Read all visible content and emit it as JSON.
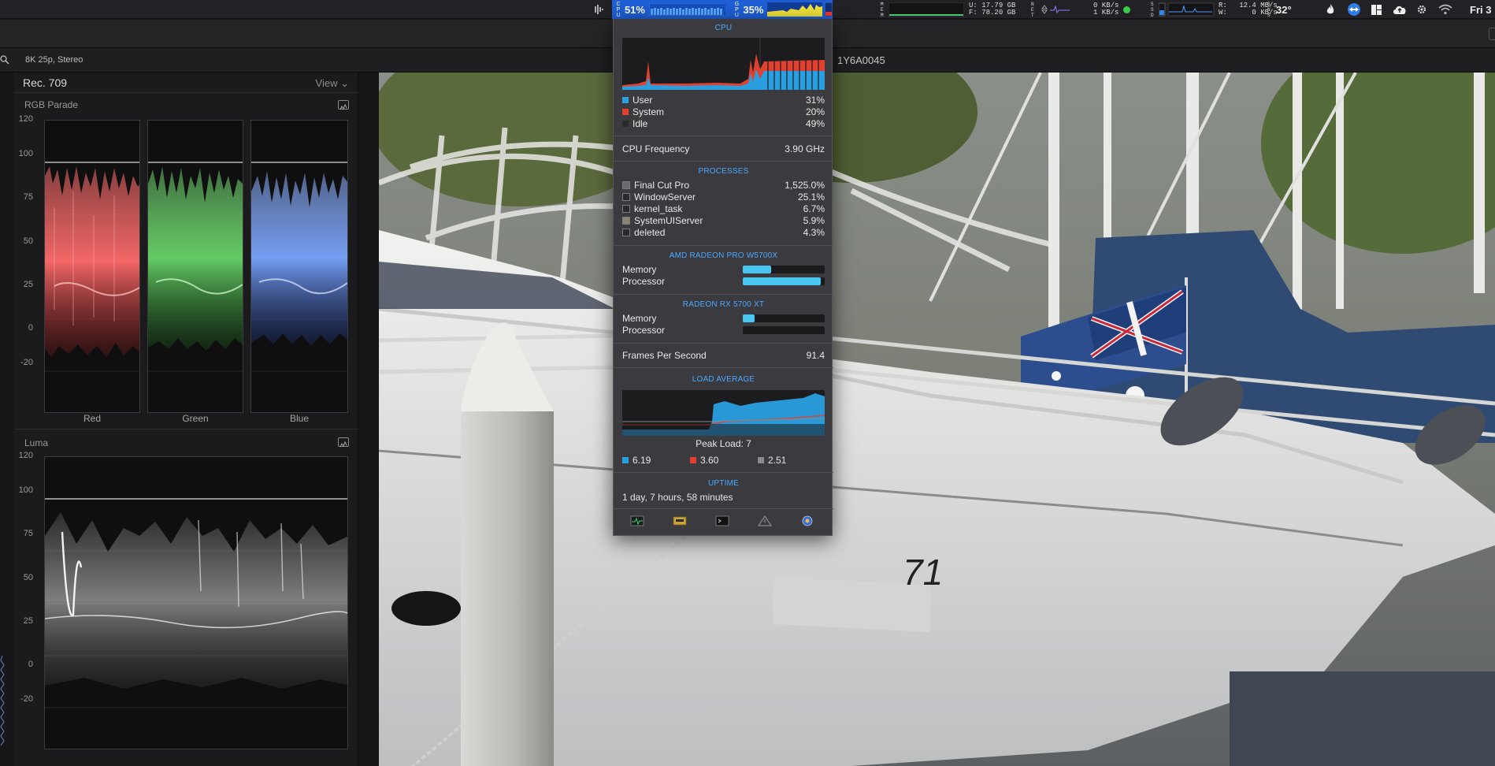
{
  "menubar": {
    "cpu_percent": "51%",
    "gpu_percent": "35%",
    "cpu_tag": "CPU",
    "gpu_tag": "GPU",
    "mem_tag": "MEM",
    "mem_used_label": "U:",
    "mem_used": "17.79 GB",
    "mem_free_label": "F:",
    "mem_free": "78.20 GB",
    "net_tag": "NET",
    "net_up": "0 KB/s",
    "net_down": "1 KB/s",
    "disk_tag": "SSD",
    "disk_read_label": "R:",
    "disk_read": "12.4 MB/s",
    "disk_write_label": "W:",
    "disk_write": "0 KB/s",
    "sensor_tag": "SNS",
    "temperature": "32°",
    "clock": "Fri 3"
  },
  "subbar": {
    "format": "8K 25p, Stereo",
    "clip_name": "1Y6A0045"
  },
  "scopes": {
    "standard": "Rec. 709",
    "view_label": "View ⌄",
    "rgb_title": "RGB Parade",
    "luma_title": "Luma",
    "axis_ticks": [
      "120",
      "100",
      "75",
      "50",
      "25",
      "0",
      "-20"
    ],
    "channels": [
      "Red",
      "Green",
      "Blue"
    ]
  },
  "dropdown": {
    "cpu_header": "CPU",
    "user_label": "User",
    "user_value": "31%",
    "system_label": "System",
    "system_value": "20%",
    "idle_label": "Idle",
    "idle_value": "49%",
    "freq_label": "CPU Frequency",
    "freq_value": "3.90 GHz",
    "processes_header": "PROCESSES",
    "processes": [
      {
        "name": "Final Cut Pro",
        "value": "1,525.0%"
      },
      {
        "name": "WindowServer",
        "value": "25.1%"
      },
      {
        "name": "kernel_task",
        "value": "6.7%"
      },
      {
        "name": "SystemUIServer",
        "value": "5.9%"
      },
      {
        "name": "deleted",
        "value": "4.3%"
      }
    ],
    "gpu1_header": "AMD RADEON PRO W5700X",
    "gpu1_memory_label": "Memory",
    "gpu1_memory": 0.35,
    "gpu1_processor_label": "Processor",
    "gpu1_processor": 0.95,
    "gpu2_header": "RADEON RX 5700 XT",
    "gpu2_memory_label": "Memory",
    "gpu2_memory": 0.14,
    "gpu2_processor_label": "Processor",
    "gpu2_processor": 0.0,
    "fps_label": "Frames Per Second",
    "fps_value": "91.4",
    "load_header": "LOAD AVERAGE",
    "peak_load": "Peak Load: 7",
    "load_1": "6.19",
    "load_5": "3.60",
    "load_15": "2.51",
    "uptime_header": "UPTIME",
    "uptime_value": "1 day, 7 hours, 58 minutes"
  },
  "colors": {
    "accent_blue": "#4aa8ff",
    "user_blue": "#2a9fe0",
    "system_red": "#e0402f",
    "gpu_bar": "#4ac6f2"
  }
}
